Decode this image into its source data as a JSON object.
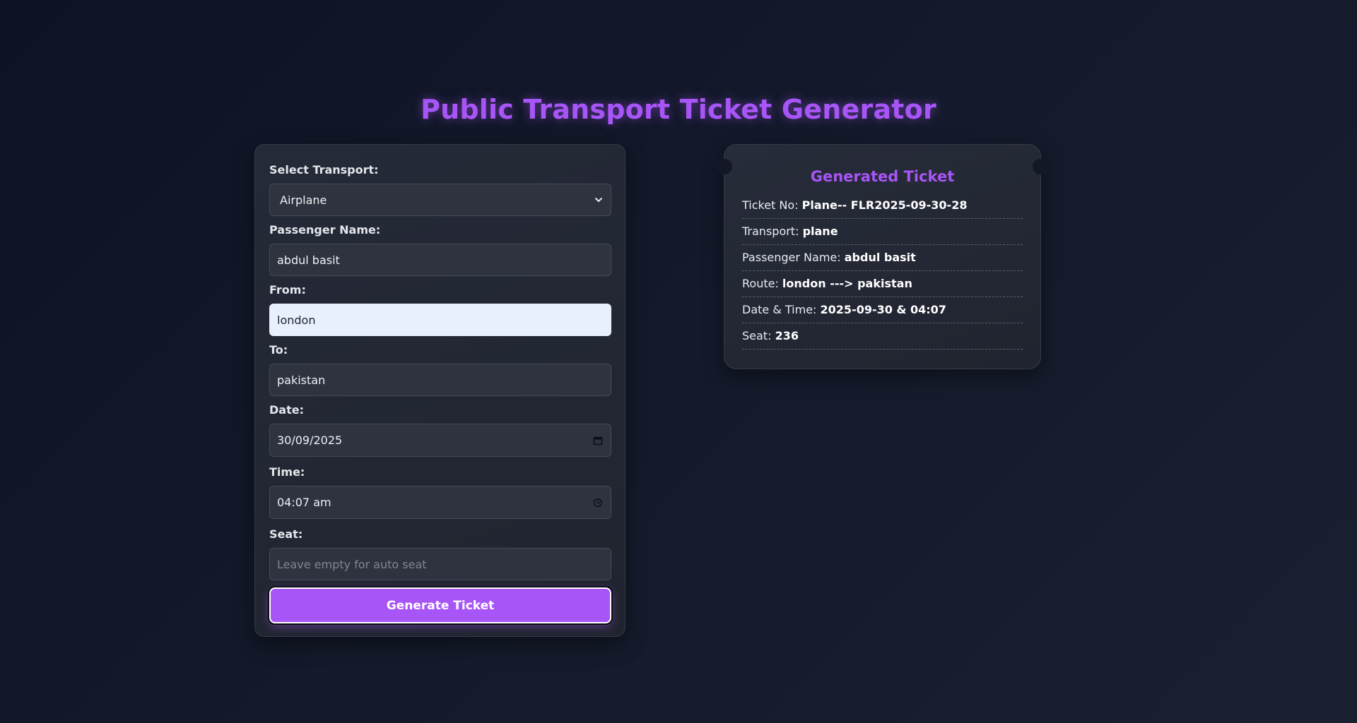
{
  "page": {
    "title": "Public Transport Ticket Generator",
    "accent_color": "#a855f7",
    "background_color": "#0e1324"
  },
  "form": {
    "transport": {
      "label": "Select Transport:",
      "selected": "Airplane",
      "icon": "chevron-down-icon"
    },
    "passenger_name": {
      "label": "Passenger Name:",
      "value": "abdul basit"
    },
    "from": {
      "label": "From:",
      "value": "london"
    },
    "to": {
      "label": "To:",
      "value": "pakistan"
    },
    "date": {
      "label": "Date:",
      "value": "30/09/2025",
      "icon": "calendar-icon"
    },
    "time": {
      "label": "Time:",
      "value": "04:07 am",
      "icon": "clock-icon"
    },
    "seat": {
      "label": "Seat:",
      "placeholder": "Leave empty for auto seat"
    },
    "submit_label": "Generate Ticket"
  },
  "ticket": {
    "title": "Generated Ticket",
    "rows": [
      {
        "label": "Ticket No: ",
        "value": "Plane-- FLR2025-09-30-28"
      },
      {
        "label": "Transport: ",
        "value": "plane"
      },
      {
        "label": "Passenger Name: ",
        "value": "abdul basit"
      },
      {
        "label": "Route: ",
        "value": "london ---> pakistan"
      },
      {
        "label": "Date & Time: ",
        "value": "2025-09-30 & 04:07"
      },
      {
        "label": "Seat: ",
        "value": "236"
      }
    ]
  }
}
